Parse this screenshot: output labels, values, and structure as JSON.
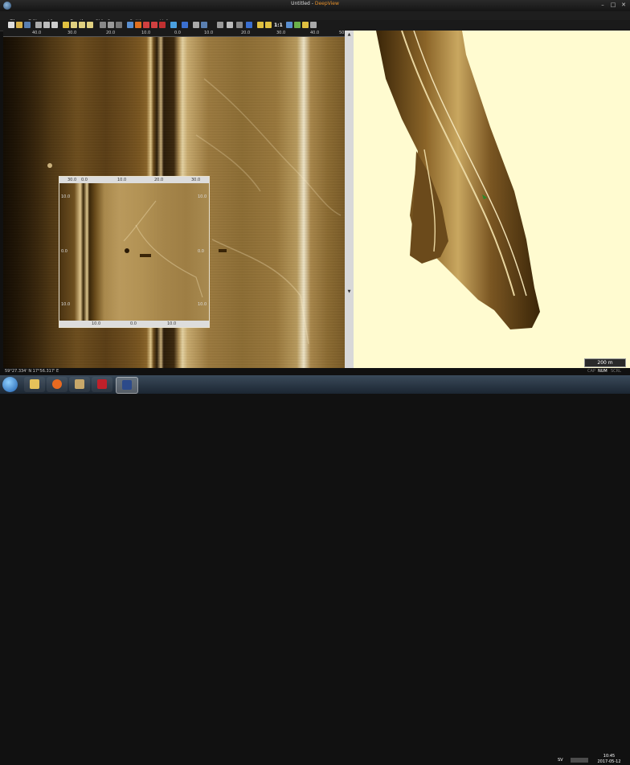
{
  "window": {
    "title": "Untitled",
    "separator": " - ",
    "app": "DeepView"
  },
  "menu": [
    "File",
    "Edit",
    "View",
    "Depth",
    "Side Scan",
    "Settings",
    "Help"
  ],
  "toolbar_zoom_label": "1:1",
  "sonar_ruler": [
    "40.0",
    "30.0",
    "20.0",
    "10.0",
    "0.0",
    "10.0",
    "20.0",
    "30.0",
    "40.0",
    "50"
  ],
  "magnifier": {
    "top_labels": [
      "30.0",
      "0.0",
      "10.0",
      "20.0",
      "30.0"
    ],
    "bottom_labels": [
      "10.0",
      "0.0",
      "10.0"
    ],
    "side_labels": [
      "10.0",
      "0.0",
      "10.0",
      "10.0",
      "0.0",
      "10.0"
    ]
  },
  "scale_bar": "200 m",
  "status": {
    "coords": "59°27.334' N  17°56.317' E",
    "caps": "CAP",
    "num": "NUM",
    "scrl": "SCRL"
  },
  "taskbar": {
    "lang": "SV",
    "time": "10:45",
    "date": "2017-05-12"
  },
  "icons": [
    "start-orb-icon",
    "folder-icon",
    "media-player-icon",
    "paint-icon",
    "antivirus-icon",
    "deepview-icon"
  ]
}
